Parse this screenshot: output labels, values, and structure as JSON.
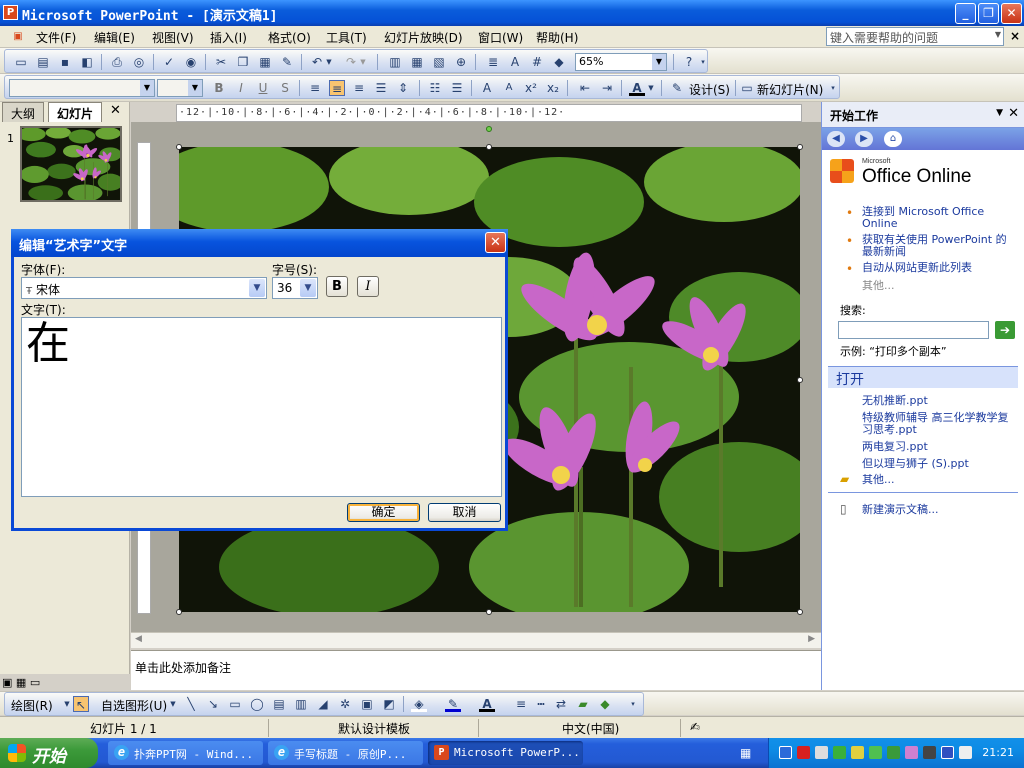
{
  "window": {
    "title": "Microsoft PowerPoint - [演示文稿1]",
    "app_icon": "powerpoint-icon"
  },
  "menus": [
    "文件(F)",
    "编辑(E)",
    "视图(V)",
    "插入(I)",
    "格式(O)",
    "工具(T)",
    "幻灯片放映(D)",
    "窗口(W)",
    "帮助(H)"
  ],
  "help": {
    "placeholder": "键入需要帮助的问题"
  },
  "standard_toolbar": {
    "zoom": "65%"
  },
  "format_toolbar": {
    "font": "",
    "size": "",
    "design_label": "设计(S)",
    "new_slide_label": "新幻灯片(N)"
  },
  "left_pane": {
    "tabs": [
      "大纲",
      "幻灯片"
    ],
    "slide_number": "1"
  },
  "ruler": {
    "h_ticks": "·12·|·10·|·8·|·6·|·4·|·2·|·0·|·2·|·4·|·6·|·8·|·10·|·12·"
  },
  "notes": {
    "placeholder": "单击此处添加备注"
  },
  "task_pane": {
    "title": "开始工作",
    "office_online": {
      "brand": "Microsoft",
      "name": "Office Online"
    },
    "links": [
      "连接到 Microsoft Office Online",
      "获取有关使用 PowerPoint 的最新新闻",
      "自动从网站更新此列表"
    ],
    "more": "其他...",
    "search_label": "搜索:",
    "example": "示例: “打印多个副本”",
    "open_section": "打开",
    "recent_files": [
      "无机推断.ppt",
      "特级教师辅导 高三化学教学复习思考.ppt",
      "两电复习.ppt",
      "但以理与狮子 (S).ppt"
    ],
    "open_more": "其他...",
    "new_presentation": "新建演示文稿..."
  },
  "dialog": {
    "title": "编辑“艺术字”文字",
    "font_label": "字体(F):",
    "font_value": "宋体",
    "size_label": "字号(S):",
    "size_value": "36",
    "bold": "B",
    "italic": "I",
    "text_label": "文字(T):",
    "text_value": "在",
    "ok": "确定",
    "cancel": "取消"
  },
  "draw_toolbar": {
    "draw_label": "绘图(R)",
    "autoshapes_label": "自选图形(U)"
  },
  "status": {
    "slide": "幻灯片 1 / 1",
    "template": "默认设计模板",
    "language": "中文(中国)"
  },
  "taskbar": {
    "start": "开始",
    "tasks": [
      "扑奔PPT网 - Wind...",
      "手写标题 - 原创P...",
      "Microsoft PowerP..."
    ],
    "clock": "21:21"
  }
}
